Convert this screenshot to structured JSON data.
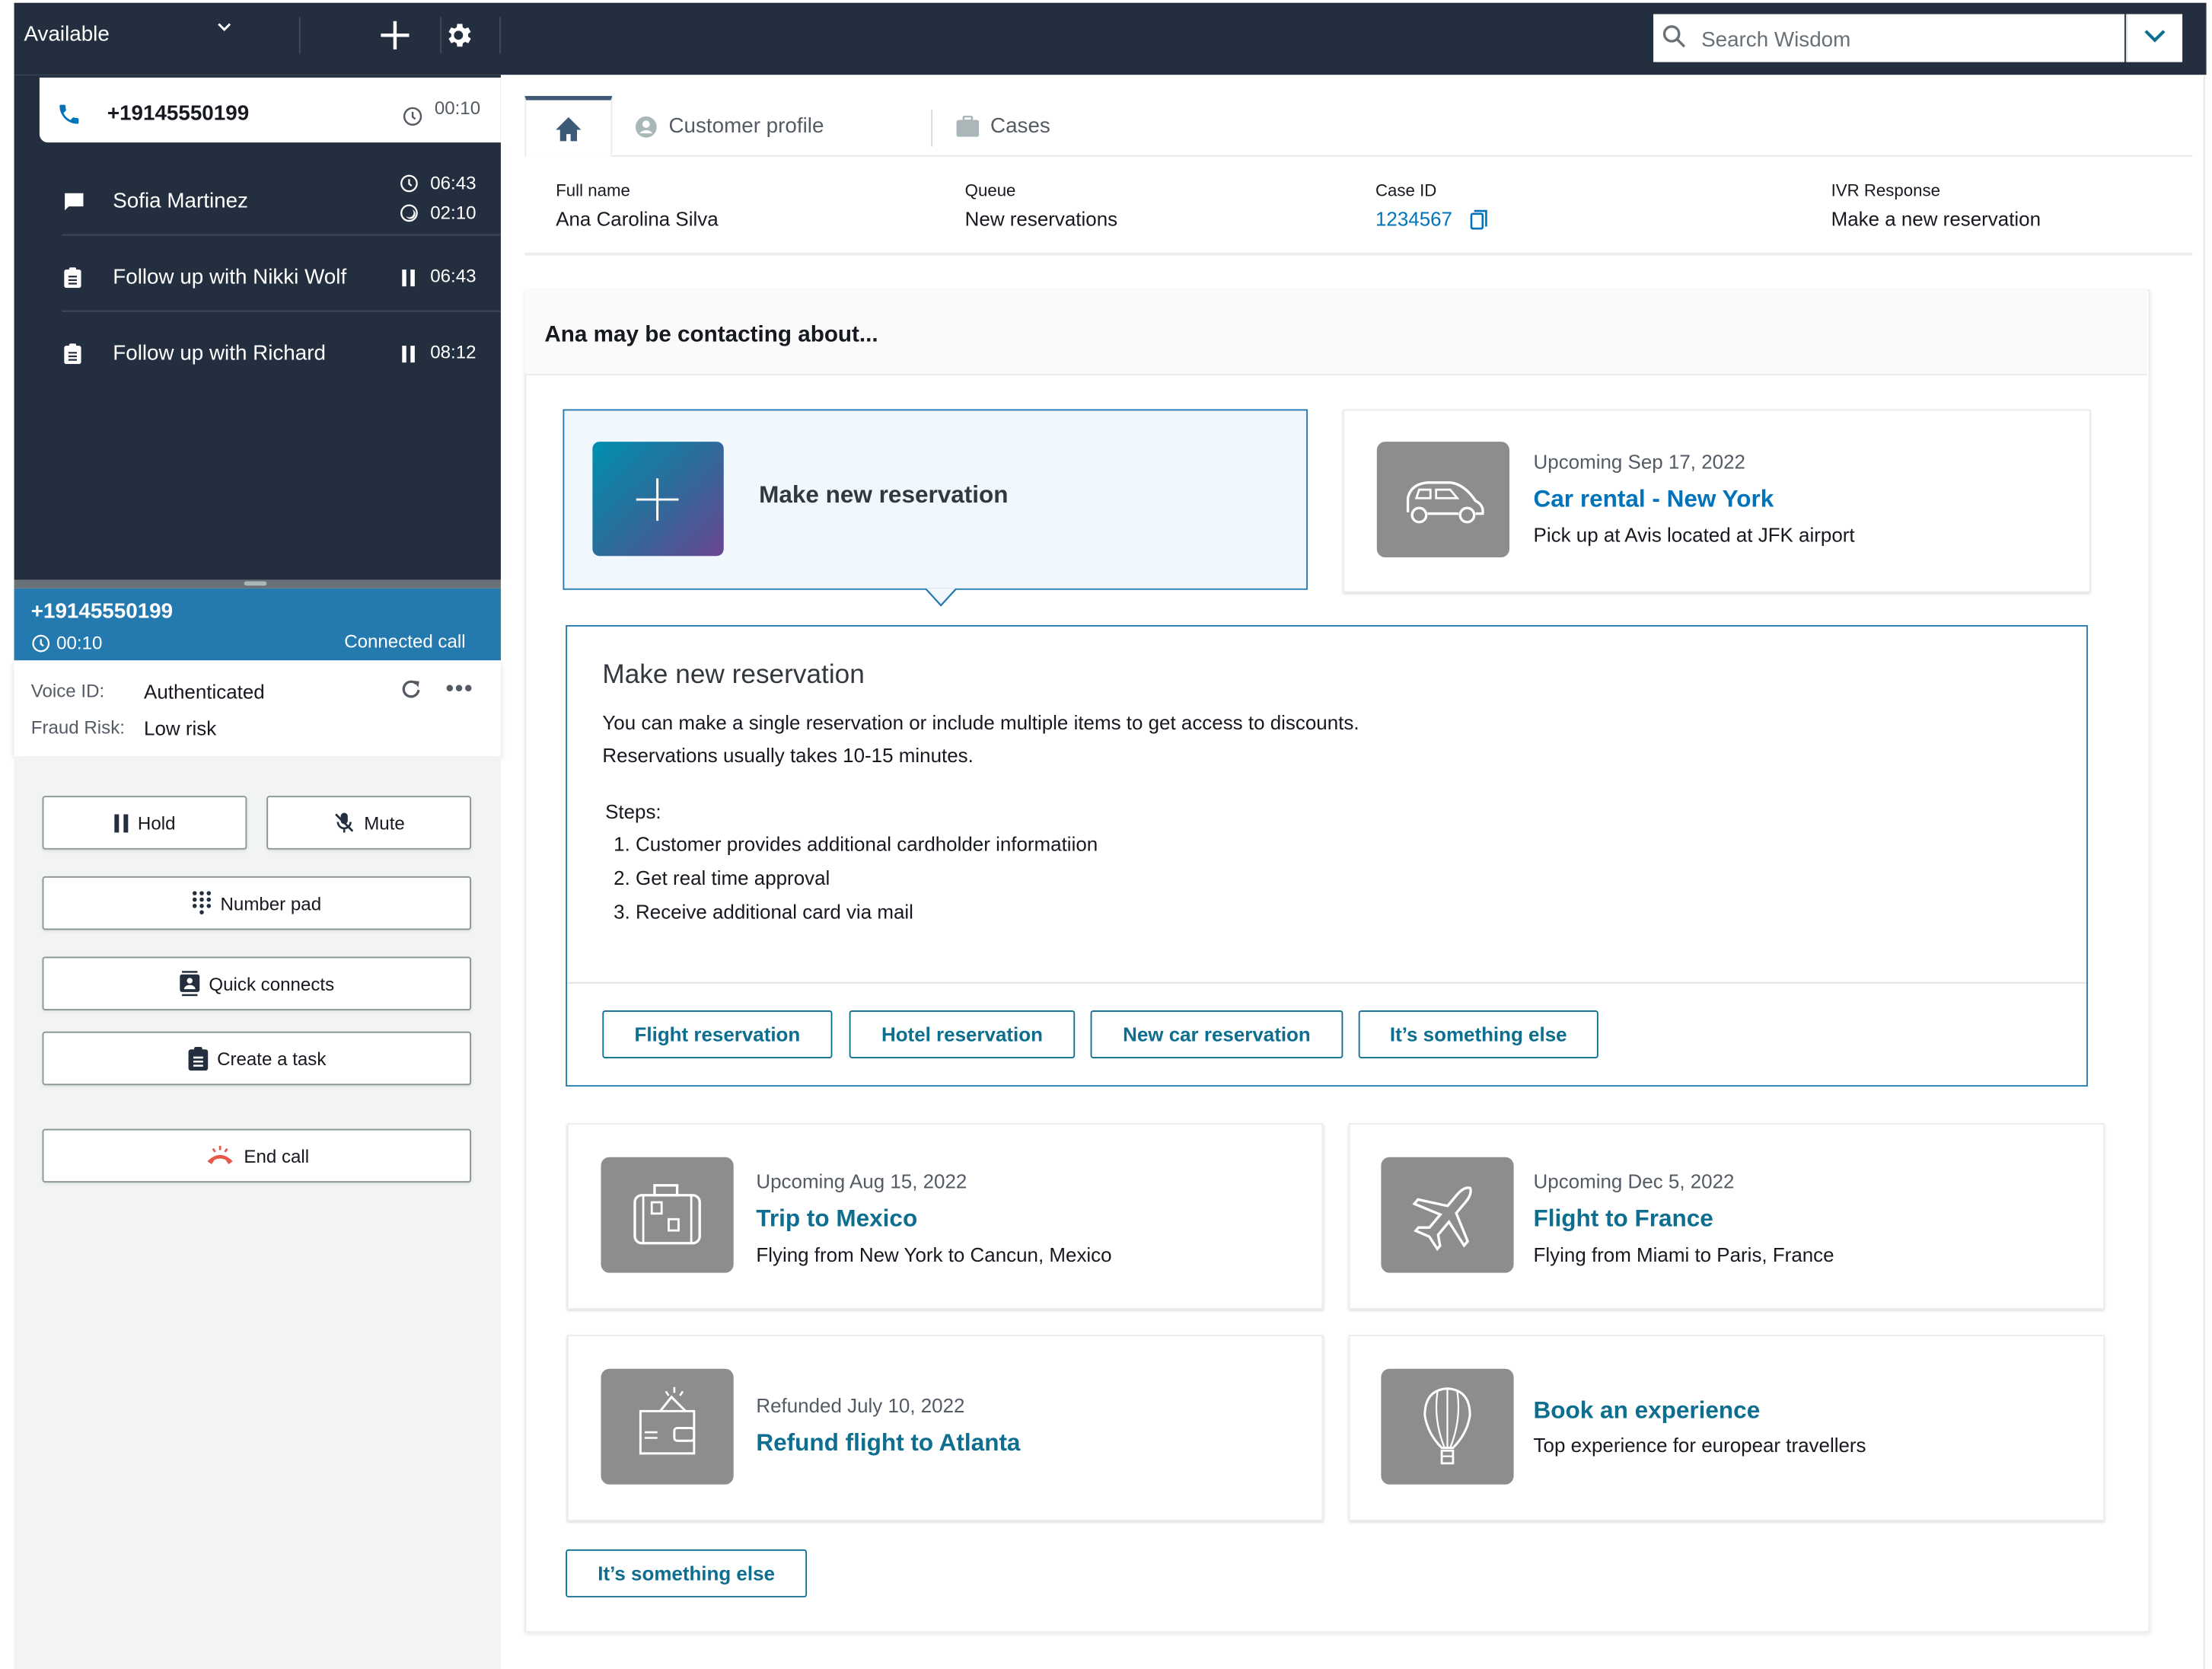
{
  "topbar": {
    "status": "Available",
    "search_placeholder": "Search Wisdom"
  },
  "contacts": {
    "active": {
      "number": "+19145550199",
      "time": "00:10"
    },
    "items": [
      {
        "label": "Sofia Martinez",
        "icon": "chat-icon",
        "time1": "06:43",
        "time2": "02:10"
      },
      {
        "label": "Follow up with Nikki Wolf",
        "icon": "task-icon",
        "time": "06:43"
      },
      {
        "label": "Follow up with Richard",
        "icon": "task-icon",
        "time": "08:12"
      }
    ]
  },
  "call": {
    "number": "+19145550199",
    "duration": "00:10",
    "state": "Connected call",
    "voice_id_label": "Voice ID:",
    "voice_id_value": "Authenticated",
    "fraud_label": "Fraud Risk:",
    "fraud_value": "Low risk"
  },
  "controls": {
    "hold": "Hold",
    "mute": "Mute",
    "number_pad": "Number pad",
    "quick_connects": "Quick connects",
    "create_task": "Create a task",
    "end_call": "End call"
  },
  "tabs": [
    {
      "label": "Home",
      "icon": "home-icon"
    },
    {
      "label": "Customer profile",
      "icon": "user-icon"
    },
    {
      "label": "Cases",
      "icon": "briefcase-icon"
    }
  ],
  "info": {
    "full_name_label": "Full name",
    "full_name": "Ana Carolina Silva",
    "queue_label": "Queue",
    "queue": "New reservations",
    "case_id_label": "Case ID",
    "case_id": "1234567",
    "ivr_label": "IVR Response",
    "ivr": "Make a new reservation"
  },
  "panel": {
    "title": "Ana may be contacting about...",
    "selected_card": {
      "title": "Make new reservation"
    },
    "car_card": {
      "sub": "Upcoming Sep 17, 2022",
      "title": "Car rental - New York",
      "desc": "Pick up at Avis located at JFK airport"
    },
    "detail": {
      "title": "Make new reservation",
      "line1": "You can make a single reservation or include multiple items to get access to discounts.",
      "line2": "Reservations usually takes 10-15 minutes.",
      "steps_label": "Steps:",
      "steps": [
        "1. Customer provides additional cardholder informatiion",
        "2. Get real time approval",
        "3. Receive additional card via mail"
      ],
      "buttons": [
        "Flight reservation",
        "Hotel reservation",
        "New car reservation",
        "It’s something else"
      ]
    },
    "cards": [
      {
        "sub": "Upcoming Aug 15, 2022",
        "title": "Trip to Mexico",
        "desc": "Flying from New York to Cancun, Mexico",
        "icon": "suitcase-icon"
      },
      {
        "sub": "Upcoming Dec 5, 2022",
        "title": "Flight to France",
        "desc": "Flying from Miami to Paris, France",
        "icon": "airplane-icon"
      },
      {
        "sub": "Refunded July 10, 2022",
        "title": "Refund flight to Atlanta",
        "icon": "wallet-refund-icon"
      },
      {
        "title": "Book an experience",
        "desc": "Top experience for europear travellers",
        "icon": "hot-air-balloon-icon"
      }
    ],
    "else_button": "It’s something else"
  },
  "colors": {
    "topbar": "#232f3e",
    "call_header": "#2479af",
    "link": "#0073bb",
    "teal": "#0e6e8f",
    "end_call_red": "#e8574b"
  }
}
